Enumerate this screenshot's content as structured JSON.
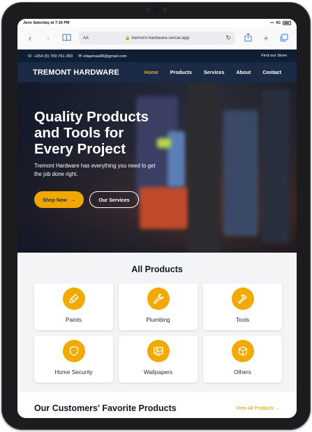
{
  "status_bar": {
    "time": "June Saturday at 7:16 PM",
    "signal": "5G"
  },
  "browser": {
    "text_size": "AA",
    "url": "tremont-hardware.vercel.app"
  },
  "topbar": {
    "phone": "+254 (0) 700 761 283",
    "email": "eliqamaa98@gmail.com",
    "store_link": "Find our Store"
  },
  "nav": {
    "brand": "TREMONT HARDWARE",
    "links": [
      "Home",
      "Products",
      "Services",
      "About",
      "Contact"
    ],
    "active": "Home"
  },
  "hero": {
    "title": "Quality Products and Tools for Every Project",
    "subtitle": "Tremont Hardware has everything you need to get the job done right.",
    "primary_button": "Shop Now",
    "secondary_button": "Our Services"
  },
  "products": {
    "title": "All Products",
    "items": [
      {
        "label": "Paints",
        "icon": "paintbrush-icon"
      },
      {
        "label": "Plumbing",
        "icon": "wrench-icon"
      },
      {
        "label": "Tools",
        "icon": "hammer-icon"
      },
      {
        "label": "Home Security",
        "icon": "shield-icon"
      },
      {
        "label": "Wallpapers",
        "icon": "image-icon"
      },
      {
        "label": "Others",
        "icon": "box-icon"
      }
    ]
  },
  "favorites": {
    "title": "Our Customers' Favorite Products",
    "view_all": "View All Products"
  },
  "colors": {
    "accent": "#f0a800",
    "navy": "#1b2b45",
    "topbar": "#0f1d35"
  }
}
